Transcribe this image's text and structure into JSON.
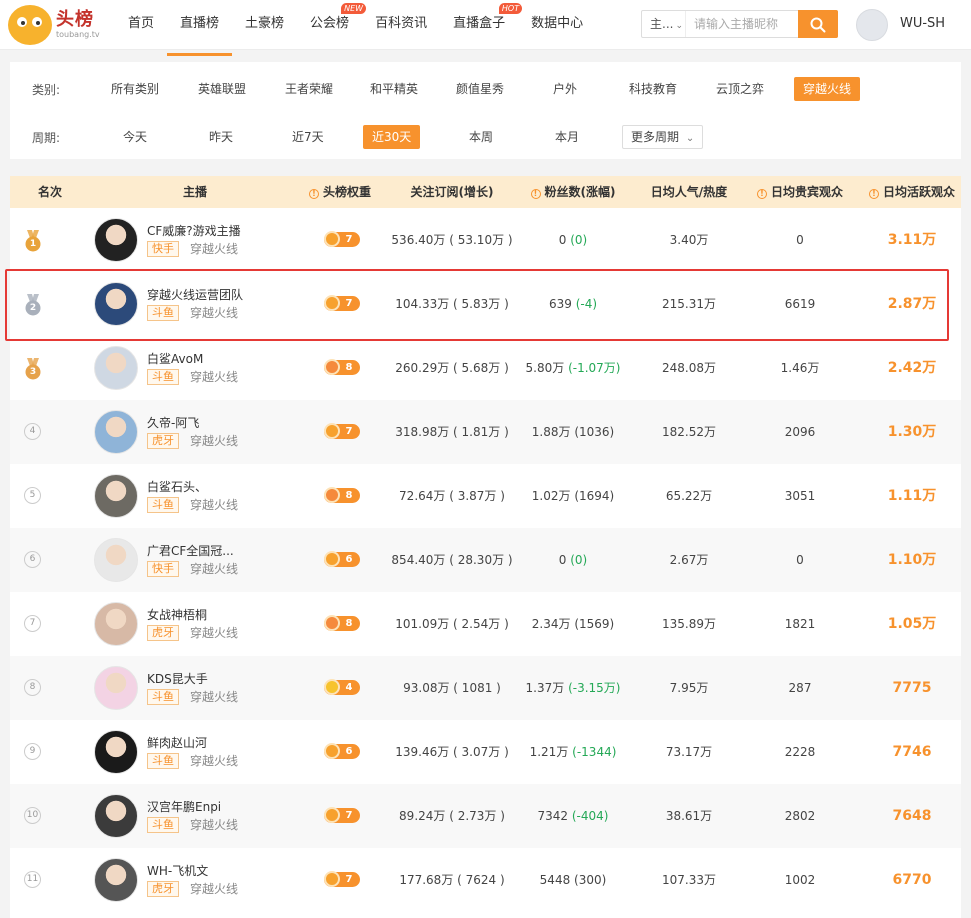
{
  "header": {
    "logo_cn": "头榜",
    "logo_en": "toubang.tv",
    "nav": [
      {
        "label": "首页",
        "badge": ""
      },
      {
        "label": "直播榜",
        "badge": "",
        "active": true
      },
      {
        "label": "土豪榜",
        "badge": ""
      },
      {
        "label": "公会榜",
        "badge": "NEW"
      },
      {
        "label": "百科资讯",
        "badge": ""
      },
      {
        "label": "直播盒子",
        "badge": "HOT"
      },
      {
        "label": "数据中心",
        "badge": ""
      }
    ],
    "search_type": "主...",
    "search_placeholder": "请输入主播昵称",
    "user_name": "WU-SH"
  },
  "filter": {
    "category_label": "类别:",
    "categories": [
      "所有类别",
      "英雄联盟",
      "王者荣耀",
      "和平精英",
      "颜值星秀",
      "户外",
      "科技教育",
      "云顶之弈",
      "穿越火线"
    ],
    "active_category": "穿越火线",
    "period_label": "周期:",
    "periods": [
      "今天",
      "昨天",
      "近7天",
      "近30天",
      "本周",
      "本月"
    ],
    "active_period": "近30天",
    "more_periods": "更多周期"
  },
  "table": {
    "columns": [
      "名次",
      "主播",
      "头榜权重",
      "关注订阅(增长)",
      "粉丝数(涨幅)",
      "日均人气/热度",
      "日均贵宾观众",
      "日均活跃观众"
    ],
    "rows": [
      {
        "rank": "1",
        "name": "CF威廉?游戏主播",
        "platform": "快手",
        "category": "穿越火线",
        "weight": "7",
        "follow": "536.40万 ( 53.10万 )",
        "fans": "0",
        "fans_delta": "(0)",
        "fans_delta_green": true,
        "popularity": "3.40万",
        "vip": "0",
        "active": "3.11万"
      },
      {
        "rank": "2",
        "name": "穿越火线运营团队",
        "platform": "斗鱼",
        "category": "穿越火线",
        "weight": "7",
        "follow": "104.33万 ( 5.83万 )",
        "fans": "639",
        "fans_delta": "(-4)",
        "fans_delta_green": true,
        "popularity": "215.31万",
        "vip": "6619",
        "active": "2.87万"
      },
      {
        "rank": "3",
        "name": "白鲨AvoM",
        "platform": "斗鱼",
        "category": "穿越火线",
        "weight": "8",
        "follow": "260.29万 ( 5.68万 )",
        "fans": "5.80万",
        "fans_delta": "(-1.07万)",
        "fans_delta_green": true,
        "popularity": "248.08万",
        "vip": "1.46万",
        "active": "2.42万"
      },
      {
        "rank": "4",
        "name": "久帝-阿飞",
        "platform": "虎牙",
        "category": "穿越火线",
        "weight": "7",
        "follow": "318.98万 ( 1.81万 )",
        "fans": "1.88万",
        "fans_delta": "(1036)",
        "fans_delta_green": false,
        "popularity": "182.52万",
        "vip": "2096",
        "active": "1.30万"
      },
      {
        "rank": "5",
        "name": "白鲨石头、",
        "platform": "斗鱼",
        "category": "穿越火线",
        "weight": "8",
        "follow": "72.64万 ( 3.87万 )",
        "fans": "1.02万",
        "fans_delta": "(1694)",
        "fans_delta_green": false,
        "popularity": "65.22万",
        "vip": "3051",
        "active": "1.11万"
      },
      {
        "rank": "6",
        "name": "广君CF全国冠...",
        "platform": "快手",
        "category": "穿越火线",
        "weight": "6",
        "follow": "854.40万 ( 28.30万 )",
        "fans": "0",
        "fans_delta": "(0)",
        "fans_delta_green": true,
        "popularity": "2.67万",
        "vip": "0",
        "active": "1.10万"
      },
      {
        "rank": "7",
        "name": "女战神梧桐",
        "platform": "虎牙",
        "category": "穿越火线",
        "weight": "8",
        "follow": "101.09万 ( 2.54万 )",
        "fans": "2.34万",
        "fans_delta": "(1569)",
        "fans_delta_green": false,
        "popularity": "135.89万",
        "vip": "1821",
        "active": "1.05万"
      },
      {
        "rank": "8",
        "name": "KDS昆大手",
        "platform": "斗鱼",
        "category": "穿越火线",
        "weight": "4",
        "follow": "93.08万 ( 1081 )",
        "fans": "1.37万",
        "fans_delta": "(-3.15万)",
        "fans_delta_green": true,
        "popularity": "7.95万",
        "vip": "287",
        "active": "7775"
      },
      {
        "rank": "9",
        "name": "鲜肉赵山河",
        "platform": "斗鱼",
        "category": "穿越火线",
        "weight": "6",
        "follow": "139.46万 ( 3.07万 )",
        "fans": "1.21万",
        "fans_delta": "(-1344)",
        "fans_delta_green": true,
        "popularity": "73.17万",
        "vip": "2228",
        "active": "7746"
      },
      {
        "rank": "10",
        "name": "汉宫年鹏Enpi",
        "platform": "斗鱼",
        "category": "穿越火线",
        "weight": "7",
        "follow": "89.24万 ( 2.73万 )",
        "fans": "7342",
        "fans_delta": "(-404)",
        "fans_delta_green": true,
        "popularity": "38.61万",
        "vip": "2802",
        "active": "7648"
      },
      {
        "rank": "11",
        "name": "WH-飞机文",
        "platform": "虎牙",
        "category": "穿越火线",
        "weight": "7",
        "follow": "177.68万 ( 7624 )",
        "fans": "5448",
        "fans_delta": "(300)",
        "fans_delta_green": false,
        "popularity": "107.33万",
        "vip": "1002",
        "active": "6770"
      }
    ]
  },
  "colors": {
    "accent": "#f7922d",
    "header_row": "#fdeccf",
    "highlight_border": "#e53935",
    "negative_delta": "#24a856"
  }
}
